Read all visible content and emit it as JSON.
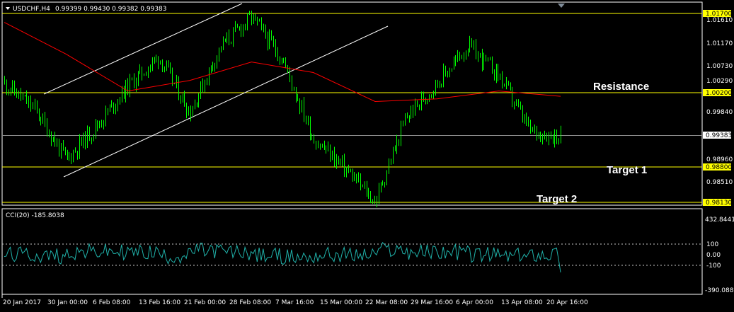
{
  "header": {
    "symbol": "USDCHF,H4",
    "ohlc": "0.99399 0.99430 0.99382 0.99383"
  },
  "indicator": {
    "title": "CCI(20) -185.8038"
  },
  "annotations": {
    "resistance": "Resistance",
    "target1": "Target 1",
    "target2": "Target 2"
  },
  "colors": {
    "background": "#000000",
    "candles": "#00ff00",
    "moving_average": "#ff0000",
    "channel": "#ffffff",
    "levels": "#ffff00",
    "cci": "#20b2aa",
    "frame": "#ffffff"
  },
  "price_axis": {
    "ticks": [
      "1.01610",
      "1.01170",
      "1.00730",
      "1.00290",
      "0.99840",
      "0.98960",
      "0.98510"
    ],
    "level_labels": [
      "1.01700",
      "1.00200",
      "0.98800",
      "0.98130"
    ],
    "current_label": "0.99383"
  },
  "cci_axis": {
    "ticks": [
      "432.8441",
      "100",
      "0.00",
      "-100",
      "-390.0885"
    ]
  },
  "time_axis": [
    "20 Jan 2017",
    "30 Jan 00:00",
    "6 Feb 08:00",
    "13 Feb 16:00",
    "21 Feb 00:00",
    "28 Feb 08:00",
    "7 Mar 16:00",
    "15 Mar 00:00",
    "22 Mar 08:00",
    "29 Mar 16:00",
    "6 Apr 00:00",
    "13 Apr 08:00",
    "20 Apr 16:00"
  ],
  "chart_data": {
    "type": "candlestick",
    "symbol": "USDCHF",
    "timeframe": "H4",
    "price_range": [
      0.981,
      1.0192
    ],
    "horizontal_levels": [
      {
        "price": 1.017
      },
      {
        "price": 1.002,
        "label": "Resistance"
      },
      {
        "price": 0.99383
      },
      {
        "price": 0.988,
        "label": "Target 1"
      },
      {
        "price": 0.9813,
        "label": "Target 2"
      }
    ],
    "price_path": [
      {
        "time": "20 Jan 2017",
        "price": 1.004
      },
      {
        "time": "30 Jan 00:00",
        "price": 0.999
      },
      {
        "time": "2 Feb",
        "price": 0.9895
      },
      {
        "time": "6 Feb 08:00",
        "price": 0.996
      },
      {
        "time": "13 Feb 16:00",
        "price": 1.0035
      },
      {
        "time": "16 Feb",
        "price": 1.009
      },
      {
        "time": "21 Feb 00:00",
        "price": 0.9985
      },
      {
        "time": "28 Feb 08:00",
        "price": 1.011
      },
      {
        "time": "7 Mar 16:00",
        "price": 1.0165
      },
      {
        "time": "10 Mar",
        "price": 1.0085
      },
      {
        "time": "15 Mar 00:00",
        "price": 0.9935
      },
      {
        "time": "22 Mar 08:00",
        "price": 0.988
      },
      {
        "time": "24 Mar",
        "price": 0.9815
      },
      {
        "time": "29 Mar 16:00",
        "price": 0.9975
      },
      {
        "time": "6 Apr 00:00",
        "price": 1.004
      },
      {
        "time": "10 Apr",
        "price": 1.011
      },
      {
        "time": "13 Apr 08:00",
        "price": 1.0055
      },
      {
        "time": "18 Apr",
        "price": 0.995
      },
      {
        "time": "20 Apr 16:00",
        "price": 0.9938
      }
    ],
    "moving_average": [
      {
        "time": "20 Jan 2017",
        "price": 1.0155
      },
      {
        "time": "30 Jan 00:00",
        "price": 1.0095
      },
      {
        "time": "13 Feb 16:00",
        "price": 1.0025
      },
      {
        "time": "28 Feb 08:00",
        "price": 1.0045
      },
      {
        "time": "7 Mar 16:00",
        "price": 1.008
      },
      {
        "time": "15 Mar 00:00",
        "price": 1.006
      },
      {
        "time": "29 Mar 16:00",
        "price": 1.0005
      },
      {
        "time": "6 Apr 00:00",
        "price": 1.001
      },
      {
        "time": "13 Apr 08:00",
        "price": 1.0025
      },
      {
        "time": "20 Apr 16:00",
        "price": 1.0015
      }
    ],
    "indicator": {
      "name": "CCI(20)",
      "last_value": -185.8038,
      "range": [
        -390.0885,
        432.8441
      ],
      "levels": [
        100,
        0,
        -100
      ]
    }
  }
}
